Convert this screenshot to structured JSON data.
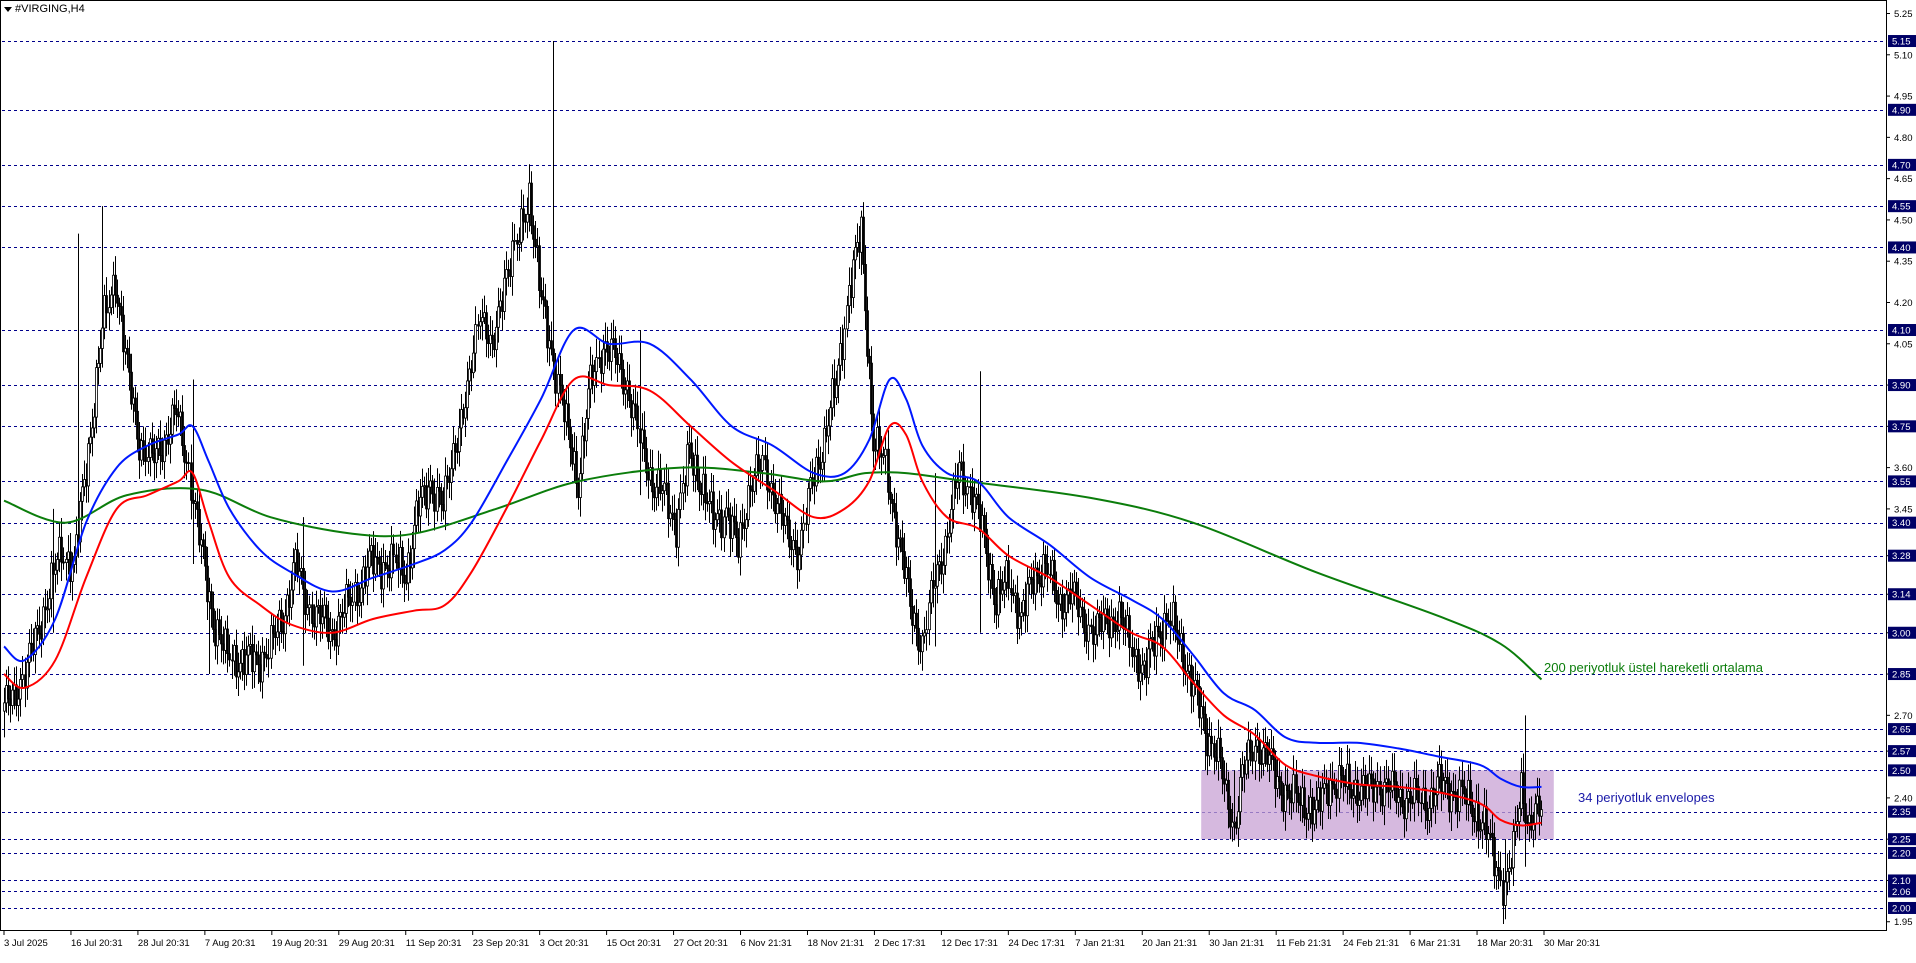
{
  "window": {
    "title": "#VIRGING,H4"
  },
  "annotations": {
    "ema200": "200 periyotluk üstel hareketli ortalama",
    "envelopes": "34 periyotluk envelopes"
  },
  "colors": {
    "background": "#ffffff",
    "axis": "#000000",
    "grid": "#00008b",
    "candle": "#000000",
    "ema200": "#0b7d0b",
    "envelope_upper": "#0018ff",
    "envelope_lower": "#ff0000",
    "zone_fill": "#c8a2d4",
    "label_bg": "#000066",
    "label_text": "#ffffff",
    "ann_green": "#0b7d0b",
    "ann_blue": "#1a1aa8"
  },
  "chart_data": {
    "type": "candlestick",
    "symbol": "#VIRGING",
    "timeframe": "H4",
    "ylim": [
      1.92,
      5.27
    ],
    "y_ticks": [
      "5.25",
      "5.10",
      "4.95",
      "4.80",
      "4.65",
      "4.50",
      "4.35",
      "4.20",
      "4.05",
      "3.90",
      "3.75",
      "3.60",
      "3.45",
      "3.28",
      "3.14",
      "3.00",
      "2.85",
      "2.70",
      "2.57",
      "2.40",
      "2.25",
      "2.10",
      "1.95"
    ],
    "grid_levels": [
      "5.15",
      "4.90",
      "4.70",
      "4.55",
      "4.40",
      "4.10",
      "3.90",
      "3.75",
      "3.55",
      "3.40",
      "3.28",
      "3.14",
      "3.00",
      "2.85",
      "2.65",
      "2.57",
      "2.50",
      "2.35",
      "2.25",
      "2.20",
      "2.10",
      "2.06",
      "2.00"
    ],
    "x_labels": [
      "3 Jul 2025",
      "16 Jul 20:31",
      "28 Jul 20:31",
      "7 Aug 20:31",
      "19 Aug 20:31",
      "29 Aug 20:31",
      "11 Sep 20:31",
      "23 Sep 20:31",
      "3 Oct 20:31",
      "15 Oct 20:31",
      "27 Oct 20:31",
      "6 Nov 21:31",
      "18 Nov 21:31",
      "2 Dec 17:31",
      "12 Dec 17:31",
      "24 Dec 17:31",
      "7 Jan 21:31",
      "20 Jan 21:31",
      "30 Jan 21:31",
      "11 Feb 21:31",
      "24 Feb 21:31",
      "6 Mar 21:31",
      "18 Mar 20:31",
      "30 Mar 20:31"
    ],
    "close_anchors": [
      [
        0,
        2.72
      ],
      [
        10,
        2.85
      ],
      [
        20,
        3.1
      ],
      [
        28,
        3.3
      ],
      [
        34,
        3.25
      ],
      [
        40,
        3.6
      ],
      [
        48,
        4.1
      ],
      [
        54,
        4.3
      ],
      [
        60,
        3.95
      ],
      [
        66,
        3.7
      ],
      [
        72,
        3.62
      ],
      [
        78,
        3.7
      ],
      [
        84,
        3.8
      ],
      [
        90,
        3.6
      ],
      [
        96,
        3.3
      ],
      [
        102,
        3.05
      ],
      [
        108,
        2.92
      ],
      [
        116,
        2.9
      ],
      [
        124,
        2.9
      ],
      [
        130,
        2.95
      ],
      [
        136,
        3.05
      ],
      [
        142,
        3.25
      ],
      [
        148,
        3.1
      ],
      [
        154,
        3.05
      ],
      [
        160,
        3.0
      ],
      [
        166,
        3.08
      ],
      [
        172,
        3.15
      ],
      [
        178,
        3.25
      ],
      [
        184,
        3.25
      ],
      [
        190,
        3.25
      ],
      [
        196,
        3.22
      ],
      [
        202,
        3.45
      ],
      [
        208,
        3.55
      ],
      [
        214,
        3.45
      ],
      [
        220,
        3.7
      ],
      [
        226,
        3.85
      ],
      [
        232,
        4.2
      ],
      [
        238,
        4.0
      ],
      [
        244,
        4.3
      ],
      [
        250,
        4.4
      ],
      [
        256,
        4.6
      ],
      [
        262,
        4.2
      ],
      [
        268,
        4.0
      ],
      [
        274,
        3.75
      ],
      [
        280,
        3.55
      ],
      [
        286,
        3.9
      ],
      [
        292,
        4.05
      ],
      [
        298,
        4.0
      ],
      [
        304,
        3.9
      ],
      [
        310,
        3.7
      ],
      [
        316,
        3.55
      ],
      [
        322,
        3.5
      ],
      [
        328,
        3.4
      ],
      [
        334,
        3.65
      ],
      [
        340,
        3.55
      ],
      [
        346,
        3.4
      ],
      [
        352,
        3.45
      ],
      [
        358,
        3.3
      ],
      [
        364,
        3.55
      ],
      [
        370,
        3.6
      ],
      [
        376,
        3.5
      ],
      [
        382,
        3.35
      ],
      [
        388,
        3.3
      ],
      [
        394,
        3.55
      ],
      [
        400,
        3.7
      ],
      [
        406,
        3.9
      ],
      [
        412,
        4.25
      ],
      [
        418,
        4.45
      ],
      [
        424,
        3.7
      ],
      [
        430,
        3.6
      ],
      [
        436,
        3.35
      ],
      [
        442,
        3.1
      ],
      [
        448,
        2.95
      ],
      [
        454,
        3.2
      ],
      [
        460,
        3.35
      ],
      [
        466,
        3.6
      ],
      [
        472,
        3.5
      ],
      [
        478,
        3.35
      ],
      [
        484,
        3.1
      ],
      [
        490,
        3.2
      ],
      [
        496,
        3.05
      ],
      [
        502,
        3.2
      ],
      [
        508,
        3.25
      ],
      [
        514,
        3.1
      ],
      [
        520,
        3.15
      ],
      [
        526,
        3.05
      ],
      [
        532,
        3.0
      ],
      [
        538,
        3.05
      ],
      [
        544,
        3.05
      ],
      [
        550,
        2.95
      ],
      [
        556,
        2.85
      ],
      [
        562,
        3.0
      ],
      [
        568,
        3.05
      ],
      [
        574,
        2.95
      ],
      [
        580,
        2.8
      ],
      [
        586,
        2.65
      ],
      [
        592,
        2.55
      ],
      [
        596,
        2.4
      ],
      [
        600,
        2.3
      ],
      [
        604,
        2.48
      ],
      [
        610,
        2.6
      ],
      [
        616,
        2.55
      ],
      [
        622,
        2.45
      ],
      [
        628,
        2.4
      ],
      [
        634,
        2.38
      ],
      [
        640,
        2.35
      ],
      [
        646,
        2.46
      ],
      [
        652,
        2.45
      ],
      [
        658,
        2.44
      ],
      [
        664,
        2.42
      ],
      [
        670,
        2.45
      ],
      [
        676,
        2.43
      ],
      [
        682,
        2.4
      ],
      [
        688,
        2.4
      ],
      [
        694,
        2.38
      ],
      [
        700,
        2.45
      ],
      [
        706,
        2.43
      ],
      [
        712,
        2.4
      ],
      [
        718,
        2.35
      ],
      [
        722,
        2.3
      ],
      [
        728,
        2.15
      ],
      [
        732,
        2.08
      ],
      [
        736,
        2.2
      ],
      [
        740,
        2.45
      ],
      [
        744,
        2.3
      ],
      [
        750,
        2.36
      ]
    ],
    "ema200_path": [
      [
        0,
        3.48
      ],
      [
        30,
        3.4
      ],
      [
        60,
        3.5
      ],
      [
        96,
        3.52
      ],
      [
        130,
        3.42
      ],
      [
        170,
        3.36
      ],
      [
        200,
        3.36
      ],
      [
        240,
        3.45
      ],
      [
        280,
        3.55
      ],
      [
        330,
        3.6
      ],
      [
        370,
        3.58
      ],
      [
        400,
        3.55
      ],
      [
        420,
        3.58
      ],
      [
        440,
        3.58
      ],
      [
        470,
        3.55
      ],
      [
        530,
        3.49
      ],
      [
        580,
        3.4
      ],
      [
        640,
        3.22
      ],
      [
        700,
        3.06
      ],
      [
        730,
        2.96
      ],
      [
        750,
        2.83
      ]
    ],
    "env_upper_path": [
      [
        0,
        2.95
      ],
      [
        10,
        2.9
      ],
      [
        25,
        3.05
      ],
      [
        40,
        3.4
      ],
      [
        55,
        3.6
      ],
      [
        70,
        3.68
      ],
      [
        85,
        3.72
      ],
      [
        92,
        3.75
      ],
      [
        100,
        3.62
      ],
      [
        110,
        3.45
      ],
      [
        125,
        3.3
      ],
      [
        140,
        3.22
      ],
      [
        160,
        3.15
      ],
      [
        180,
        3.2
      ],
      [
        200,
        3.25
      ],
      [
        215,
        3.3
      ],
      [
        228,
        3.4
      ],
      [
        245,
        3.62
      ],
      [
        262,
        3.85
      ],
      [
        278,
        4.1
      ],
      [
        295,
        4.05
      ],
      [
        315,
        4.05
      ],
      [
        335,
        3.92
      ],
      [
        355,
        3.75
      ],
      [
        375,
        3.68
      ],
      [
        395,
        3.58
      ],
      [
        410,
        3.58
      ],
      [
        422,
        3.7
      ],
      [
        432,
        3.92
      ],
      [
        440,
        3.85
      ],
      [
        448,
        3.68
      ],
      [
        460,
        3.58
      ],
      [
        475,
        3.55
      ],
      [
        490,
        3.42
      ],
      [
        510,
        3.32
      ],
      [
        530,
        3.2
      ],
      [
        550,
        3.12
      ],
      [
        565,
        3.05
      ],
      [
        580,
        2.92
      ],
      [
        595,
        2.78
      ],
      [
        610,
        2.72
      ],
      [
        625,
        2.62
      ],
      [
        640,
        2.6
      ],
      [
        660,
        2.6
      ],
      [
        680,
        2.58
      ],
      [
        700,
        2.55
      ],
      [
        720,
        2.52
      ],
      [
        730,
        2.47
      ],
      [
        740,
        2.44
      ],
      [
        750,
        2.44
      ]
    ],
    "env_lower_path": [
      [
        0,
        2.85
      ],
      [
        10,
        2.8
      ],
      [
        25,
        2.9
      ],
      [
        40,
        3.2
      ],
      [
        55,
        3.45
      ],
      [
        70,
        3.5
      ],
      [
        85,
        3.55
      ],
      [
        92,
        3.58
      ],
      [
        100,
        3.4
      ],
      [
        110,
        3.2
      ],
      [
        125,
        3.1
      ],
      [
        140,
        3.03
      ],
      [
        160,
        3.0
      ],
      [
        180,
        3.05
      ],
      [
        200,
        3.08
      ],
      [
        215,
        3.1
      ],
      [
        228,
        3.22
      ],
      [
        245,
        3.45
      ],
      [
        262,
        3.7
      ],
      [
        278,
        3.92
      ],
      [
        295,
        3.9
      ],
      [
        315,
        3.88
      ],
      [
        335,
        3.75
      ],
      [
        355,
        3.62
      ],
      [
        375,
        3.52
      ],
      [
        395,
        3.42
      ],
      [
        410,
        3.45
      ],
      [
        422,
        3.55
      ],
      [
        432,
        3.75
      ],
      [
        440,
        3.72
      ],
      [
        448,
        3.55
      ],
      [
        460,
        3.42
      ],
      [
        475,
        3.38
      ],
      [
        490,
        3.28
      ],
      [
        510,
        3.2
      ],
      [
        530,
        3.1
      ],
      [
        550,
        3.0
      ],
      [
        565,
        2.95
      ],
      [
        580,
        2.82
      ],
      [
        595,
        2.7
      ],
      [
        610,
        2.63
      ],
      [
        625,
        2.52
      ],
      [
        640,
        2.48
      ],
      [
        660,
        2.45
      ],
      [
        680,
        2.44
      ],
      [
        700,
        2.42
      ],
      [
        720,
        2.38
      ],
      [
        730,
        2.32
      ],
      [
        740,
        2.3
      ],
      [
        750,
        2.31
      ]
    ],
    "zone": {
      "x_from": 584,
      "x_to": 756,
      "price_high": 2.5,
      "price_low": 2.25
    },
    "spikes": [
      [
        0,
        2.62,
        2.8
      ],
      [
        24,
        3.0,
        3.45
      ],
      [
        36,
        3.45,
        4.45
      ],
      [
        48,
        4.0,
        4.55
      ],
      [
        92,
        3.25,
        3.92
      ],
      [
        100,
        2.85,
        3.2
      ],
      [
        146,
        2.88,
        3.42
      ],
      [
        256,
        4.5,
        4.7
      ],
      [
        268,
        4.0,
        5.15
      ],
      [
        310,
        3.5,
        4.1
      ],
      [
        418,
        4.3,
        4.5
      ],
      [
        424,
        3.6,
        3.9
      ],
      [
        454,
        2.95,
        3.58
      ],
      [
        476,
        3.0,
        3.95
      ],
      [
        586,
        2.5,
        2.75
      ],
      [
        600,
        2.25,
        2.5
      ],
      [
        732,
        2.05,
        2.25
      ],
      [
        742,
        2.15,
        2.7
      ]
    ]
  }
}
